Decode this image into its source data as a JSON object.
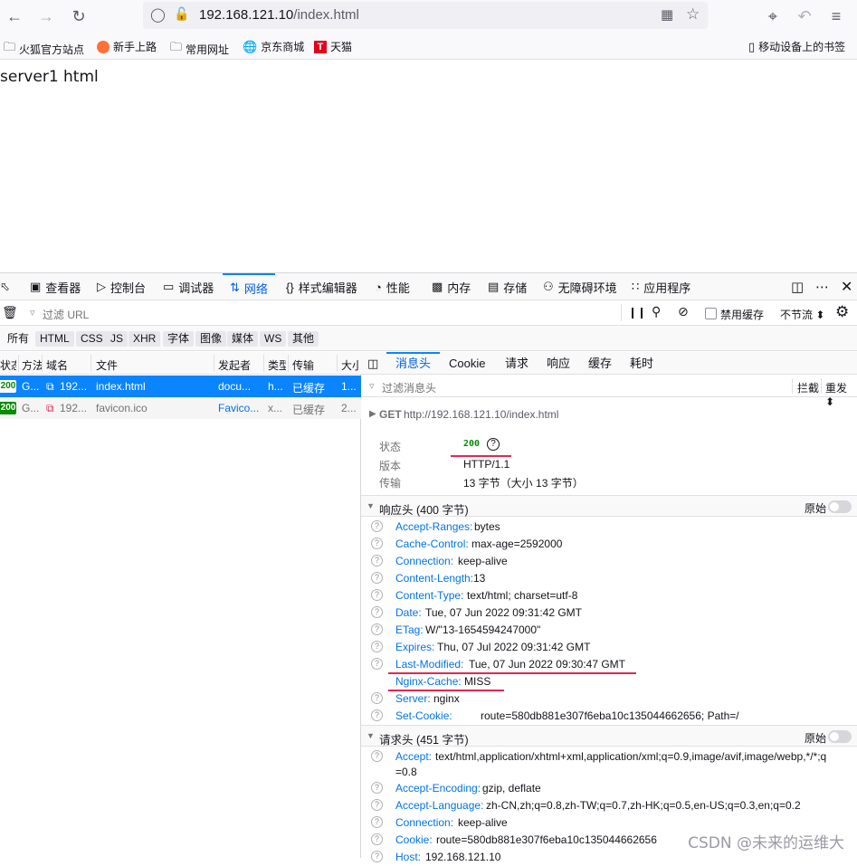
{
  "toolbar": {
    "url_host": "192.168.121.10",
    "url_path": "/index.html"
  },
  "bookmarks": {
    "items": [
      "火狐官方站点",
      "新手上路",
      "常用网址",
      "京东商城",
      "天猫"
    ],
    "mobile": "移动设备上的书签"
  },
  "page": {
    "text": "server1 html"
  },
  "devtools": {
    "tabs": [
      "查看器",
      "控制台",
      "调试器",
      "网络",
      "样式编辑器",
      "性能",
      "内存",
      "存储",
      "无障碍环境",
      "应用程序"
    ],
    "filter_placeholder": "过滤 URL",
    "disable_cache": "禁用缓存",
    "throttle": "不节流 ⬍",
    "types": [
      "所有",
      "HTML",
      "CSS",
      "JS",
      "XHR",
      "字体",
      "图像",
      "媒体",
      "WS",
      "其他"
    ],
    "columns": [
      "状态",
      "方法",
      "域名",
      "文件",
      "发起者",
      "类型",
      "传输",
      "大小"
    ],
    "requests": [
      {
        "status": "200",
        "method": "G...",
        "domain": "192...",
        "file": "index.html",
        "initiator": "docu...",
        "type": "h...",
        "transfer": "已缓存",
        "size": "1..."
      },
      {
        "status": "200",
        "method": "G...",
        "domain": "192...",
        "file": "favicon.ico",
        "initiator": "Favico...",
        "type": "x...",
        "transfer": "已缓存",
        "size": "2..."
      }
    ],
    "detail_tabs": [
      "消息头",
      "Cookie",
      "请求",
      "响应",
      "缓存",
      "耗时"
    ],
    "detail_filter": "过滤消息头",
    "block": "拦截",
    "resend": "重发 ⬍",
    "summary": {
      "method": "GET",
      "url": "http://192.168.121.10/index.html",
      "status_label": "状态",
      "status_value": "200",
      "version_label": "版本",
      "version_value": "HTTP/1.1",
      "transfer_label": "传输",
      "transfer_value": "13 字节（大小 13 字节）"
    },
    "response_headers_title": "响应头 (400 字节)",
    "raw_label": "原始",
    "response_headers": [
      {
        "k": "Accept-Ranges:",
        "v": "bytes"
      },
      {
        "k": "Cache-Control:",
        "v": "max-age=2592000"
      },
      {
        "k": "Connection:",
        "v": "keep-alive"
      },
      {
        "k": "Content-Length:",
        "v": "13"
      },
      {
        "k": "Content-Type:",
        "v": "text/html; charset=utf-8"
      },
      {
        "k": "Date:",
        "v": "Tue, 07 Jun 2022 09:31:42 GMT"
      },
      {
        "k": "ETag:",
        "v": "W/\"13-1654594247000\""
      },
      {
        "k": "Expires:",
        "v": "Thu, 07 Jul 2022 09:31:42 GMT"
      },
      {
        "k": "Last-Modified:",
        "v": "Tue, 07 Jun 2022 09:30:47 GMT"
      },
      {
        "k": "Nginx-Cache:",
        "v": "MISS"
      },
      {
        "k": "Server:",
        "v": "nginx"
      },
      {
        "k": "Set-Cookie:",
        "v": "route=580db881e307f6eba10c135044662656; Path=/"
      }
    ],
    "request_headers_title": "请求头 (451 字节)",
    "request_headers": [
      {
        "k": "Accept:",
        "v": "text/html,application/xhtml+xml,application/xml;q=0.9,image/avif,image/webp,*/*;q",
        "v2": "=0.8"
      },
      {
        "k": "Accept-Encoding:",
        "v": "gzip, deflate"
      },
      {
        "k": "Accept-Language:",
        "v": "zh-CN,zh;q=0.8,zh-TW;q=0.7,zh-HK;q=0.5,en-US;q=0.3,en;q=0.2"
      },
      {
        "k": "Connection:",
        "v": "keep-alive"
      },
      {
        "k": "Cookie:",
        "v": "route=580db881e307f6eba10c135044662656"
      },
      {
        "k": "Host:",
        "v": "192.168.121.10"
      }
    ]
  },
  "watermark": "CSDN @未来的运维大"
}
